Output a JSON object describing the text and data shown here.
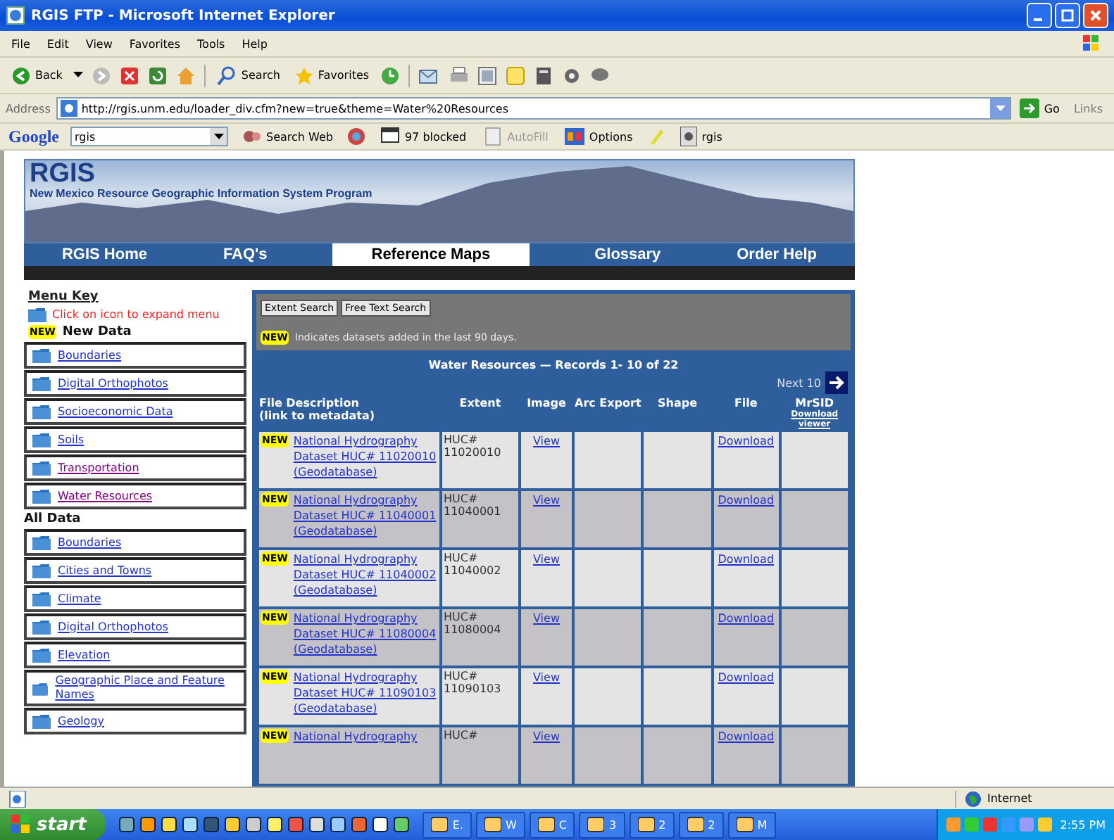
{
  "window": {
    "title": "RGIS FTP - Microsoft Internet Explorer"
  },
  "menu": [
    "File",
    "Edit",
    "View",
    "Favorites",
    "Tools",
    "Help"
  ],
  "toolbar": {
    "back": "Back",
    "search": "Search",
    "favorites": "Favorites"
  },
  "address": {
    "label": "Address",
    "url": "http://rgis.unm.edu/loader_div.cfm?new=true&theme=Water%20Resources",
    "go": "Go",
    "links": "Links"
  },
  "google_bar": {
    "logo": "Google",
    "query": "rgis",
    "search_web": "Search Web",
    "blocked": "97 blocked",
    "autofill": "AutoFill",
    "options": "Options",
    "bookmark": "rgis"
  },
  "banner": {
    "title": "RGIS",
    "subtitle": "New Mexico Resource Geographic Information System Program"
  },
  "nav": [
    {
      "label": "RGIS Home",
      "selected": false
    },
    {
      "label": "FAQ's",
      "selected": false
    },
    {
      "label": "Reference Maps",
      "selected": true
    },
    {
      "label": "Glossary",
      "selected": false
    },
    {
      "label": "Order Help",
      "selected": false
    }
  ],
  "sidebar": {
    "menu_key": "Menu Key",
    "hint": "Click on icon to expand menu",
    "new_badge": "NEW",
    "new_heading": "New Data",
    "new_items": [
      {
        "label": "Boundaries",
        "visited": false
      },
      {
        "label": "Digital Orthophotos",
        "visited": false
      },
      {
        "label": "Socioeconomic Data",
        "visited": false
      },
      {
        "label": "Soils",
        "visited": false
      },
      {
        "label": "Transportation",
        "visited": true
      },
      {
        "label": "Water Resources",
        "visited": true
      }
    ],
    "all_heading": "All Data",
    "all_items": [
      {
        "label": "Boundaries",
        "visited": false
      },
      {
        "label": "Cities and Towns",
        "visited": false
      },
      {
        "label": "Climate",
        "visited": false
      },
      {
        "label": "Digital Orthophotos",
        "visited": false
      },
      {
        "label": "Elevation",
        "visited": false
      },
      {
        "label": "Geographic Place and Feature Names",
        "visited": false
      },
      {
        "label": "Geology",
        "visited": false
      }
    ]
  },
  "search_buttons": [
    "Extent Search",
    "Free Text Search"
  ],
  "new_note": {
    "badge": "NEW",
    "text": "Indicates datasets added in the last 90 days."
  },
  "records": {
    "title": "Water Resources — Records 1- 10 of 22",
    "next": "Next 10"
  },
  "table": {
    "columns": [
      {
        "label": "File Description",
        "sub": "(link to metadata)"
      },
      {
        "label": "Extent"
      },
      {
        "label": "Image"
      },
      {
        "label": "Arc Export"
      },
      {
        "label": "Shape"
      },
      {
        "label": "File"
      },
      {
        "label": "MrSID",
        "sub": "Download viewer"
      }
    ],
    "rows": [
      {
        "new": true,
        "badge": "NEW",
        "description": "National Hydrography Dataset HUC# 11020010 (Geodatabase)",
        "extent": "HUC# 11020010",
        "image": "View",
        "file": "Download"
      },
      {
        "new": true,
        "badge": "NEW",
        "description": "National Hydrography Dataset HUC# 11040001 (Geodatabase)",
        "extent": "HUC# 11040001",
        "image": "View",
        "file": "Download"
      },
      {
        "new": true,
        "badge": "NEW",
        "description": "National Hydrography Dataset HUC# 11040002 (Geodatabase)",
        "extent": "HUC# 11040002",
        "image": "View",
        "file": "Download"
      },
      {
        "new": true,
        "badge": "NEW",
        "description": "National Hydrography Dataset HUC# 11080004 (Geodatabase)",
        "extent": "HUC# 11080004",
        "image": "View",
        "file": "Download"
      },
      {
        "new": true,
        "badge": "NEW",
        "description": "National Hydrography Dataset HUC# 11090103 (Geodatabase)",
        "extent": "HUC# 11090103",
        "image": "View",
        "file": "Download"
      },
      {
        "new": true,
        "badge": "NEW",
        "description": "National Hydrography",
        "extent": "HUC#",
        "image": "View",
        "file": "Download"
      }
    ]
  },
  "status_bar": {
    "zone": "Internet"
  },
  "taskbar": {
    "start": "start",
    "tasks": [
      "E.",
      "W",
      "C",
      "3",
      "2",
      "2",
      "M"
    ],
    "clock": "2:55 PM"
  }
}
